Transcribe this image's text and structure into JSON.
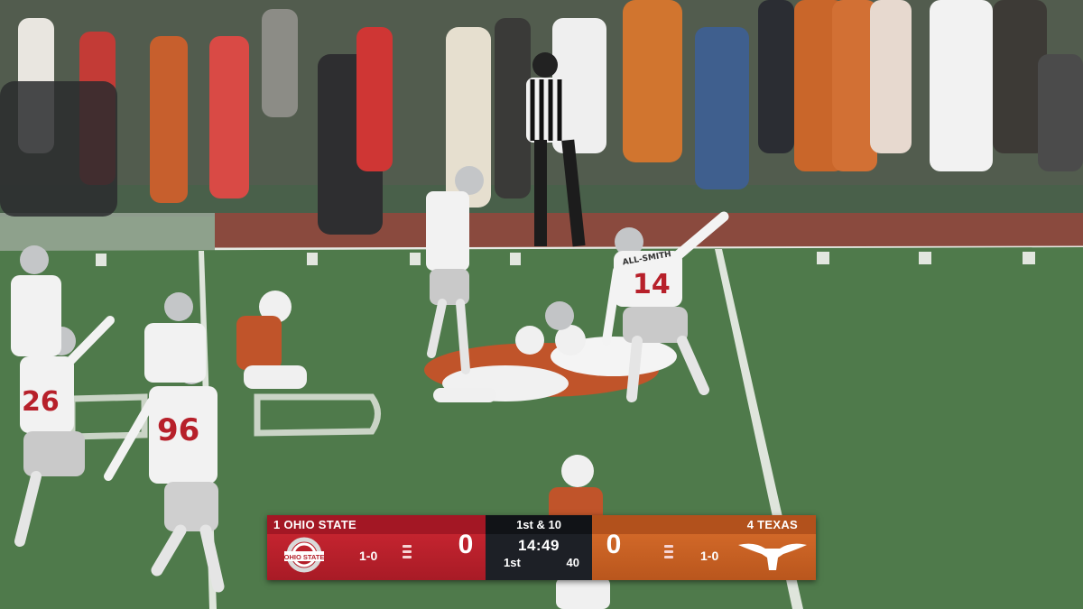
{
  "scorebug": {
    "away": {
      "rank": "1",
      "name": "OHIO STATE",
      "label": "1 OHIO STATE",
      "logo_text": "OHIO STATE",
      "record": "1-0",
      "score": "0",
      "color": "#bb1f2a",
      "timeouts_remaining": 3
    },
    "home": {
      "rank": "4",
      "name": "TEXAS",
      "label": "4 TEXAS",
      "record": "1-0",
      "score": "0",
      "color": "#c75b22",
      "logo_icon": "longhorn-icon",
      "timeouts_remaining": 3
    },
    "situation": {
      "down_distance": "1st & 10",
      "clock": "14:49",
      "quarter": "1st",
      "play_clock": "40"
    }
  },
  "field": {
    "jersey_numbers": [
      "14",
      "96",
      "26"
    ],
    "nameplate": "ALL-SMITH"
  }
}
